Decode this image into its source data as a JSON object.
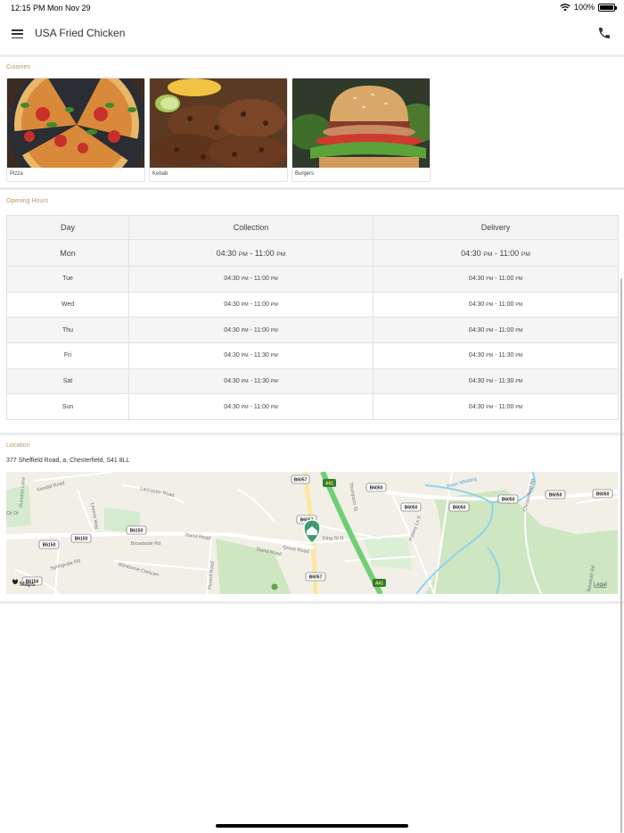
{
  "status_bar": {
    "time": "12:15 PM",
    "date": "Mon Nov 29",
    "battery": "100%"
  },
  "navbar": {
    "title": "USA Fried Chicken"
  },
  "cuisines": {
    "label": "Cuisines",
    "items": [
      {
        "name": "Pizza"
      },
      {
        "name": "Kebab"
      },
      {
        "name": "Burgers"
      }
    ]
  },
  "opening_hours": {
    "label": "Opening Hours",
    "headers": {
      "day": "Day",
      "collection": "Collection",
      "delivery": "Delivery"
    },
    "rows": [
      {
        "day": "Mon",
        "collection": [
          "04:30",
          "PM",
          " - 11:00",
          "PM"
        ],
        "delivery": [
          "04:30",
          "PM",
          " - 11:00",
          "PM"
        ]
      },
      {
        "day": "Tue",
        "collection": [
          "04:30",
          "PM",
          " - 11:00",
          "PM"
        ],
        "delivery": [
          "04:30",
          "PM",
          " - 11:00",
          "PM"
        ]
      },
      {
        "day": "Wed",
        "collection": [
          "04:30",
          "PM",
          " - 11:00",
          "PM"
        ],
        "delivery": [
          "04:30",
          "PM",
          " - 11:00",
          "PM"
        ]
      },
      {
        "day": "Thu",
        "collection": [
          "04:30",
          "PM",
          " - 11:00",
          "PM"
        ],
        "delivery": [
          "04:30",
          "PM",
          " - 11:00",
          "PM"
        ]
      },
      {
        "day": "Fri",
        "collection": [
          "04:30",
          "PM",
          " - 11:30",
          "PM"
        ],
        "delivery": [
          "04:30",
          "PM",
          " - 11:30",
          "PM"
        ]
      },
      {
        "day": "Sat",
        "collection": [
          "04:30",
          "PM",
          " - 11:30",
          "PM"
        ],
        "delivery": [
          "04:30",
          "PM",
          " - 11:30",
          "PM"
        ]
      },
      {
        "day": "Sun",
        "collection": [
          "04:30",
          "PM",
          " - 11:00",
          "PM"
        ],
        "delivery": [
          "04:30",
          "PM",
          " - 11:00",
          "PM"
        ]
      }
    ]
  },
  "location": {
    "label": "Location",
    "address": "377 Sheffield Road, a, Chesterfield, S41 8LL",
    "map": {
      "attribution": "Maps",
      "legal": "Legal",
      "road_badges": [
        "B6057",
        "A61",
        "B6050",
        "B6050",
        "B6050",
        "B6050",
        "B6050",
        "B6050",
        "B6150",
        "B6150",
        "B6150",
        "B6150",
        "B6057",
        "B6057",
        "A61"
      ],
      "street_labels": [
        "Dunston Lane",
        "Kendal Road",
        "Lancaster Road",
        "Stand Road",
        "Stand Road",
        "Grove Road",
        "King St N",
        "Peveril Road",
        "Wimborne Crescen",
        "Springvale Rd",
        "Thompson St",
        "River Whitting",
        "Pottery Ln E",
        "Chesterfield Rd",
        "Newbold Rd",
        "Levens Way",
        "Broadside Rd",
        "Ck Dr"
      ]
    }
  }
}
